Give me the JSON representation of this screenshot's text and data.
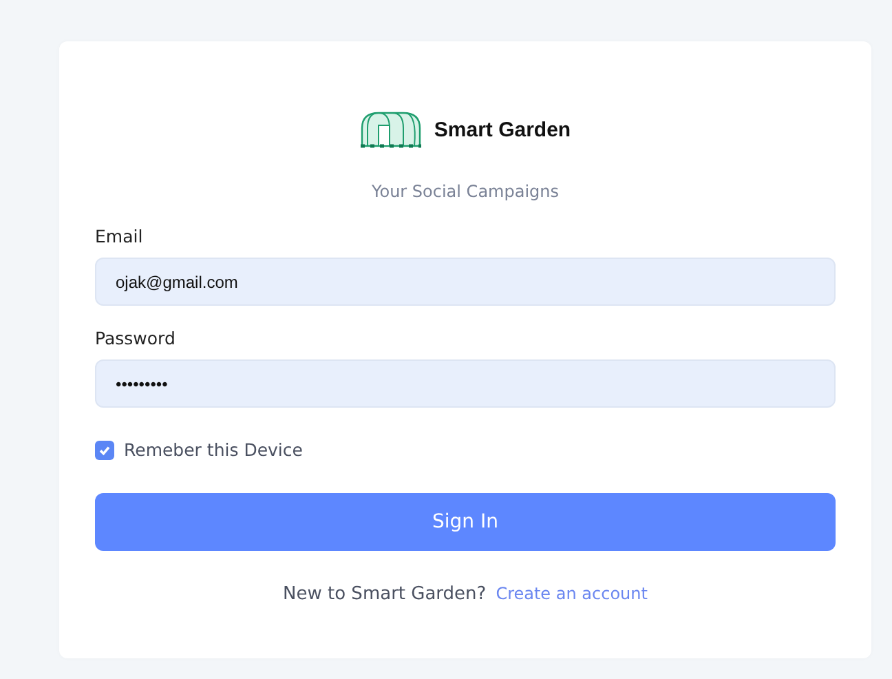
{
  "brand": {
    "name": "Smart Garden"
  },
  "subtitle": "Your Social Campaigns",
  "fields": [
    {
      "label": "Email",
      "value": "ojak@gmail.com"
    },
    {
      "label": "Password",
      "value": "•••••••••"
    }
  ],
  "remember": {
    "label": "Remeber this Device",
    "checked": true
  },
  "submit": "Sign In",
  "footer": {
    "text": "New to Smart Garden?",
    "link": "Create an account"
  }
}
